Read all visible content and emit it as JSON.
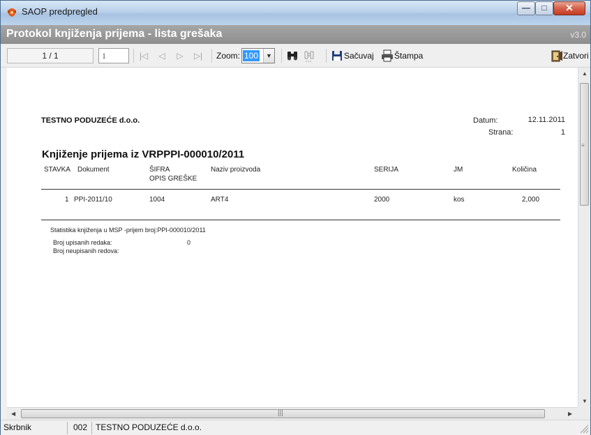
{
  "window": {
    "title": "SAOP predpregled",
    "minimize_glyph": "—",
    "maximize_glyph": "□",
    "close_glyph": "✕"
  },
  "header": {
    "title": "Protokol knjiženja prijema - lista grešaka",
    "version": "v3.0"
  },
  "toolbar": {
    "page_indicator": "1 / 1",
    "page_input": "1",
    "nav_first": "|◁",
    "nav_prev": "◁",
    "nav_next": "▷",
    "nav_last": "▷|",
    "zoom_label": "Zoom:",
    "zoom_value": "100",
    "save_label": "Sačuvaj",
    "print_label": "Štampa",
    "close_label": "Zatvori"
  },
  "report": {
    "company": "TESTNO PODUZEĆE d.o.o.",
    "date_label": "Datum:",
    "date_value": "12.11.2011",
    "page_label": "Strana:",
    "page_value": "1",
    "title": "Knjiženje prijema iz VRPPPI-000010/2011",
    "columns": {
      "stavka": "STAVKA",
      "dokument": "Dokument",
      "sifra": "ŠIFRA",
      "opis": "OPIS GREŠKE",
      "naziv": "Naziv proizvoda",
      "serija": "SERIJA",
      "jm": "JM",
      "kolicina": "Količina"
    },
    "rows": [
      {
        "stavka": "1",
        "dokument": "PPI-2011/10",
        "sifra": "1004",
        "naziv": "ART4",
        "serija": "2000",
        "jm": "kos",
        "kolicina": "2,000"
      }
    ],
    "stats_title": "Statistika knjiženja u MSP -prijem broj:PPI-000010/2011",
    "written_label": "Broj upisanih redaka:",
    "written_value": "0",
    "unwritten_label": "Broj neupisanih redova:"
  },
  "statusbar": {
    "user_label": "Skrbnik",
    "company_code": "002",
    "company_name": "TESTNO PODUZEĆE d.o.o."
  },
  "scrollbar": {
    "grip": "|||"
  },
  "colors": {
    "header_band": "#9a9a9a",
    "zoom_highlight": "#3399ff",
    "close_button": "#c9452d"
  }
}
